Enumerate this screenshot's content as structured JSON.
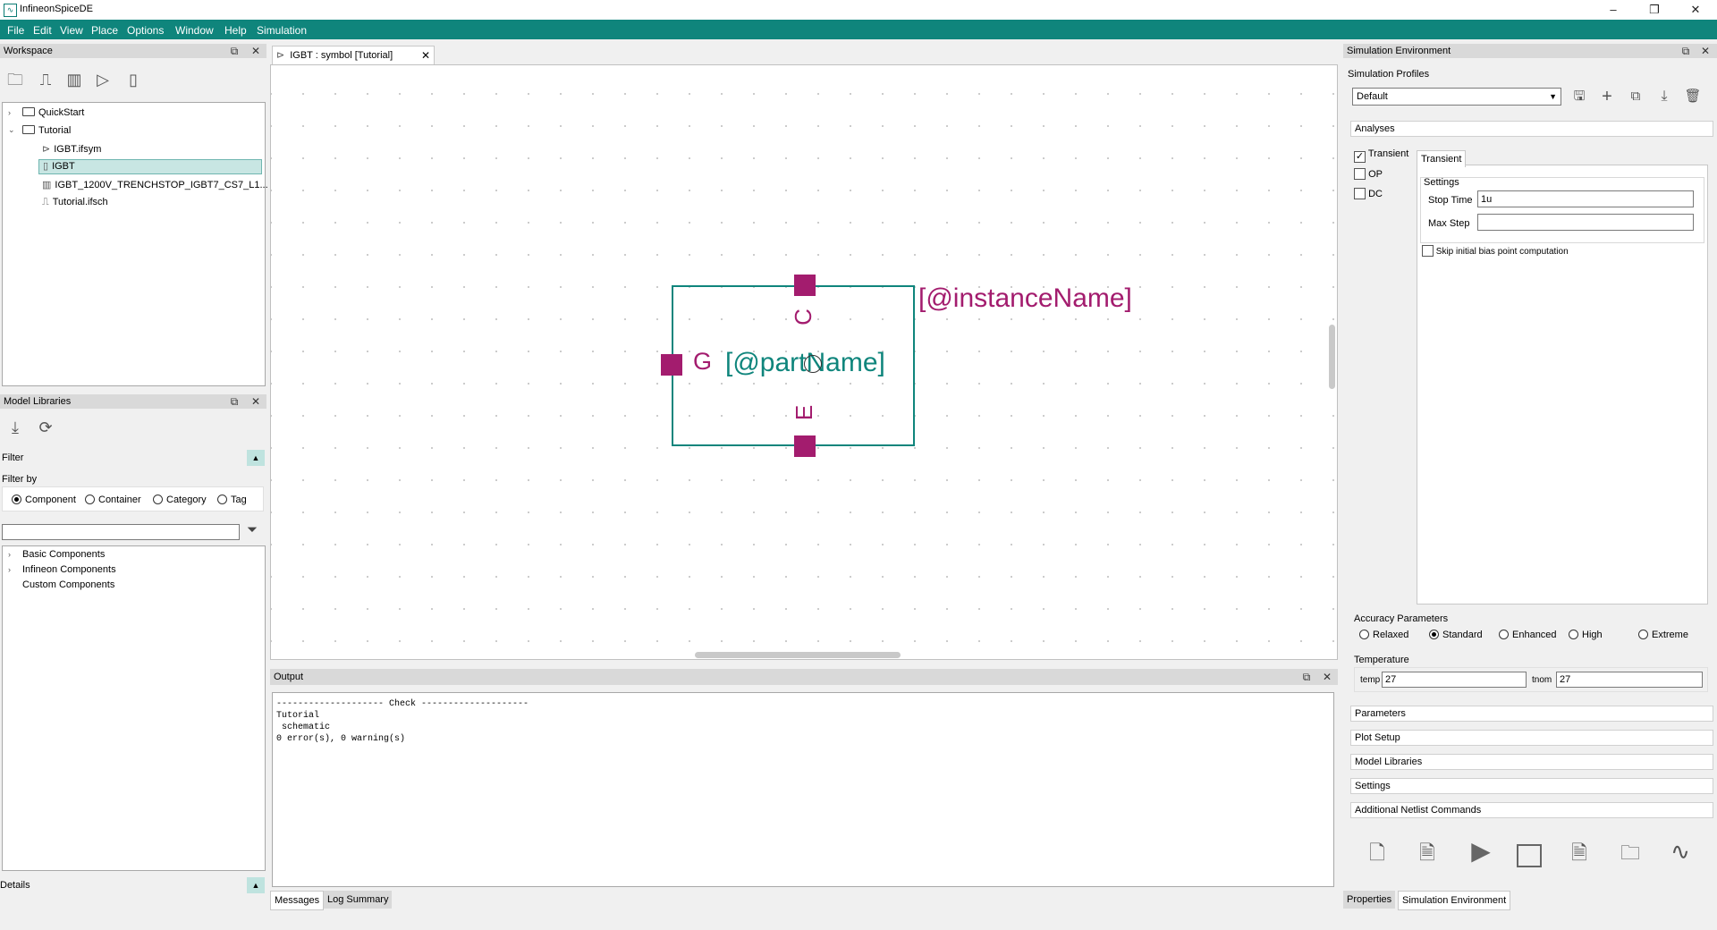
{
  "app": {
    "title": "InfineonSpiceDE"
  },
  "menu": [
    "File",
    "Edit",
    "View",
    "Place",
    "Options",
    "Window",
    "Help",
    "Simulation"
  ],
  "workspace": {
    "title": "Workspace",
    "tree": [
      {
        "label": "QuickStart"
      },
      {
        "label": "Tutorial"
      },
      {
        "label": "IGBT.ifsym"
      },
      {
        "label": "IGBT"
      },
      {
        "label": "IGBT_1200V_TRENCHSTOP_IGBT7_CS7_L1..."
      },
      {
        "label": "Tutorial.ifsch"
      }
    ]
  },
  "model_libraries": {
    "title": "Model Libraries",
    "filter_label": "Filter",
    "filter_by_label": "Filter by",
    "filter_options": [
      "Component",
      "Container",
      "Category",
      "Tag"
    ],
    "search_value": "",
    "tree": [
      "Basic Components",
      "Infineon Components",
      "Custom Components"
    ],
    "details_label": "Details"
  },
  "editor": {
    "tab_label": "IGBT : symbol [Tutorial]",
    "symbol": {
      "instance_name": "[@instanceName]",
      "part_name": "[@partName]",
      "pin_gate": "G",
      "pin_collector": "C",
      "pin_emitter": "E"
    },
    "colors": {
      "frame": "#0f857c",
      "pin": "#a31c6e"
    }
  },
  "output": {
    "title": "Output",
    "lines": [
      "-------------------- Check --------------------",
      "Tutorial",
      " schematic",
      "0 error(s), 0 warning(s)"
    ],
    "tabs": [
      "Messages",
      "Log Summary"
    ]
  },
  "sim_env": {
    "title": "Simulation Environment",
    "profiles_label": "Simulation Profiles",
    "profile_value": "Default",
    "analyses_label": "Analyses",
    "analyses": [
      {
        "label": "Transient",
        "checked": true
      },
      {
        "label": "OP",
        "checked": false
      },
      {
        "label": "DC",
        "checked": false
      }
    ],
    "active_tab": "Transient",
    "settings_label": "Settings",
    "stop_time_label": "Stop Time",
    "stop_time_value": "1u",
    "max_step_label": "Max Step",
    "max_step_value": "",
    "skip_bias_label": "Skip initial bias point computation",
    "accuracy_label": "Accuracy Parameters",
    "accuracy_options": [
      "Relaxed",
      "Standard",
      "Enhanced",
      "High",
      "Extreme"
    ],
    "accuracy_selected": "Standard",
    "temperature_label": "Temperature",
    "temp_label": "temp",
    "temp_value": "27",
    "tnom_label": "tnom",
    "tnom_value": "27",
    "sections": [
      "Parameters",
      "Plot Setup",
      "Model Libraries",
      "Settings",
      "Additional Netlist Commands"
    ],
    "bottom_tabs": [
      "Properties",
      "Simulation Environment"
    ]
  }
}
